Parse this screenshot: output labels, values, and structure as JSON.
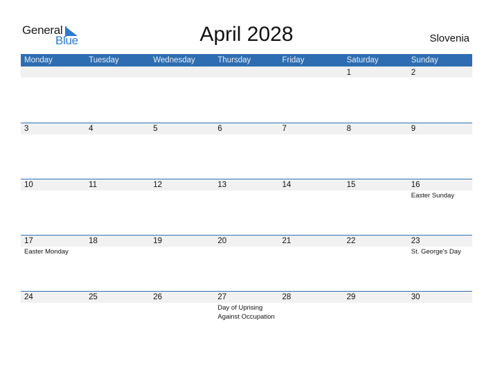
{
  "logo": {
    "line1": "General",
    "line2": "Blue"
  },
  "title": "April 2028",
  "country": "Slovenia",
  "colors": {
    "header": "#2e6db1",
    "band": "#f1f1f1",
    "logo_blue": "#2b7bd0"
  },
  "weekdays": [
    "Monday",
    "Tuesday",
    "Wednesday",
    "Thursday",
    "Friday",
    "Saturday",
    "Sunday"
  ],
  "weeks": [
    {
      "days": [
        {
          "num": "",
          "holiday": ""
        },
        {
          "num": "",
          "holiday": ""
        },
        {
          "num": "",
          "holiday": ""
        },
        {
          "num": "",
          "holiday": ""
        },
        {
          "num": "",
          "holiday": ""
        },
        {
          "num": "1",
          "holiday": ""
        },
        {
          "num": "2",
          "holiday": ""
        }
      ]
    },
    {
      "days": [
        {
          "num": "3",
          "holiday": ""
        },
        {
          "num": "4",
          "holiday": ""
        },
        {
          "num": "5",
          "holiday": ""
        },
        {
          "num": "6",
          "holiday": ""
        },
        {
          "num": "7",
          "holiday": ""
        },
        {
          "num": "8",
          "holiday": ""
        },
        {
          "num": "9",
          "holiday": ""
        }
      ]
    },
    {
      "days": [
        {
          "num": "10",
          "holiday": ""
        },
        {
          "num": "11",
          "holiday": ""
        },
        {
          "num": "12",
          "holiday": ""
        },
        {
          "num": "13",
          "holiday": ""
        },
        {
          "num": "14",
          "holiday": ""
        },
        {
          "num": "15",
          "holiday": ""
        },
        {
          "num": "16",
          "holiday": "Easter Sunday"
        }
      ]
    },
    {
      "days": [
        {
          "num": "17",
          "holiday": "Easter Monday"
        },
        {
          "num": "18",
          "holiday": ""
        },
        {
          "num": "19",
          "holiday": ""
        },
        {
          "num": "20",
          "holiday": ""
        },
        {
          "num": "21",
          "holiday": ""
        },
        {
          "num": "22",
          "holiday": ""
        },
        {
          "num": "23",
          "holiday": "St. George's Day"
        }
      ]
    },
    {
      "days": [
        {
          "num": "24",
          "holiday": ""
        },
        {
          "num": "25",
          "holiday": ""
        },
        {
          "num": "26",
          "holiday": ""
        },
        {
          "num": "27",
          "holiday": "Day of Uprising Against Occupation"
        },
        {
          "num": "28",
          "holiday": ""
        },
        {
          "num": "29",
          "holiday": ""
        },
        {
          "num": "30",
          "holiday": ""
        }
      ]
    }
  ]
}
